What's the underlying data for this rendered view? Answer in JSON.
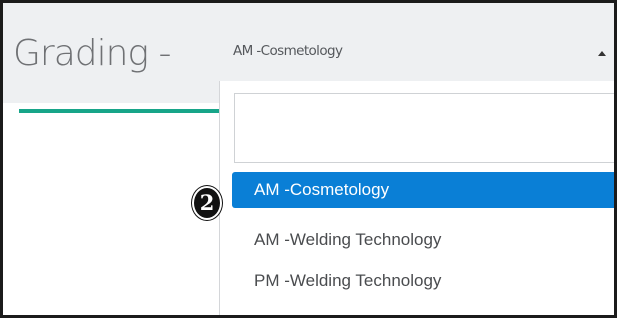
{
  "header": {
    "title": "Grading -"
  },
  "select": {
    "value": "AM -Cosmetology",
    "caret_icon": "caret-up-icon"
  },
  "dropdown": {
    "search_value": "",
    "options": [
      {
        "label": "AM -Cosmetology",
        "selected": true
      },
      {
        "label": "AM -Welding Technology",
        "selected": false
      },
      {
        "label": "PM -Welding Technology",
        "selected": false
      }
    ]
  },
  "annotation": {
    "step_marker": "2"
  },
  "colors": {
    "accent_underline": "#17a589",
    "selected_option": "#0a7fd6",
    "header_background": "#eef0f2",
    "frame_border": "#1b1b1b"
  }
}
